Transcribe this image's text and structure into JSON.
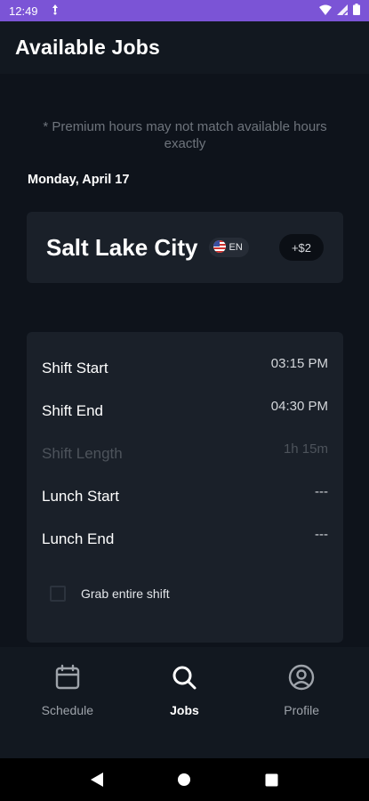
{
  "status_bar": {
    "time": "12:49"
  },
  "header": {
    "title": "Available Jobs"
  },
  "notice": "* Premium hours may not match available hours exactly",
  "date_label": "Monday, April 17",
  "location": {
    "city": "Salt Lake City",
    "language": "EN",
    "premium": "+$2"
  },
  "shift": {
    "rows": [
      {
        "label": "Shift Start",
        "value": "03:15 PM"
      },
      {
        "label": "Shift End",
        "value": "04:30 PM"
      },
      {
        "label": "Shift Length",
        "value": "1h 15m"
      },
      {
        "label": "Lunch Start",
        "value": "---"
      },
      {
        "label": "Lunch End",
        "value": "---"
      }
    ],
    "grab_entire_label": "Grab entire shift"
  },
  "bottom_nav": {
    "items": [
      {
        "label": "Schedule",
        "icon": "calendar-icon"
      },
      {
        "label": "Jobs",
        "icon": "search-icon"
      },
      {
        "label": "Profile",
        "icon": "user-circle-icon"
      }
    ],
    "active": "Jobs"
  },
  "colors": {
    "status_bar": "#7b54d6",
    "background": "#0e131b",
    "card": "#1a2029",
    "header": "#121820"
  }
}
